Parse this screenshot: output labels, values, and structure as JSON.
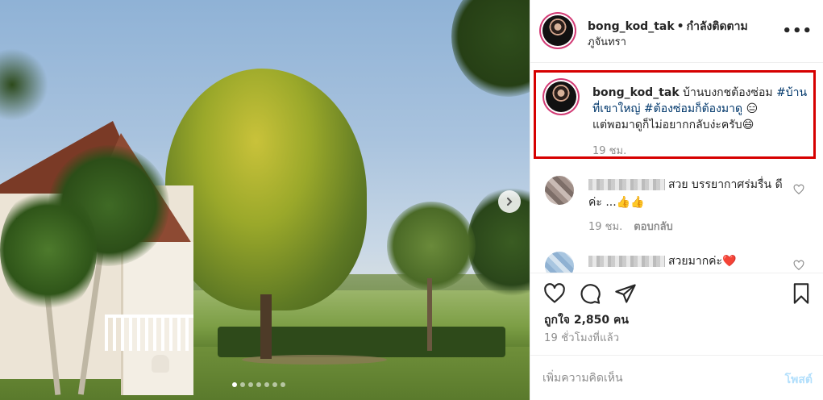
{
  "post": {
    "username": "bong_kod_tak",
    "follow_status": "กำลังติดตาม",
    "separator": "•",
    "location": "ภูจันทรา",
    "more_label": "•••",
    "photo_dot_count": 7,
    "photo_active_index": 0
  },
  "caption": {
    "username": "bong_kod_tak",
    "text": "บ้านบงกชต้องซ่อม",
    "hashtag1": "#บ้านที่เขาใหญ่",
    "hashtag2": "#ต้องซ่อมก็ต้องมาดู",
    "emoji1": "😑",
    "line2": "แต่พอมาดูก็ไม่อยากกลับง่ะครับ😄",
    "time": "19 ชม."
  },
  "comments": [
    {
      "text": "สวย บรรยากาศร่มรื่น ดีค่ะ ...👍👍",
      "time": "19 ชม.",
      "reply_label": "ตอบกลับ"
    },
    {
      "text": "สวยมากค่ะ❤️"
    }
  ],
  "stats": {
    "likes": "ถูกใจ 2,850 คน",
    "posted_ago": "19 ชั่วโมงที่แล้ว"
  },
  "add_comment": {
    "placeholder": "เพิ่มความคิดเห็น",
    "post_label": "โพสต์"
  },
  "icons": {
    "like": "heart-icon",
    "comment": "comment-icon",
    "share": "paper-plane-icon",
    "save": "bookmark-icon",
    "next": "chevron-right-icon"
  },
  "colors": {
    "highlight_box": "#d60000",
    "hashtag": "#00376b",
    "muted": "#8e8e8e",
    "post_button_disabled": "#b2dffc"
  }
}
